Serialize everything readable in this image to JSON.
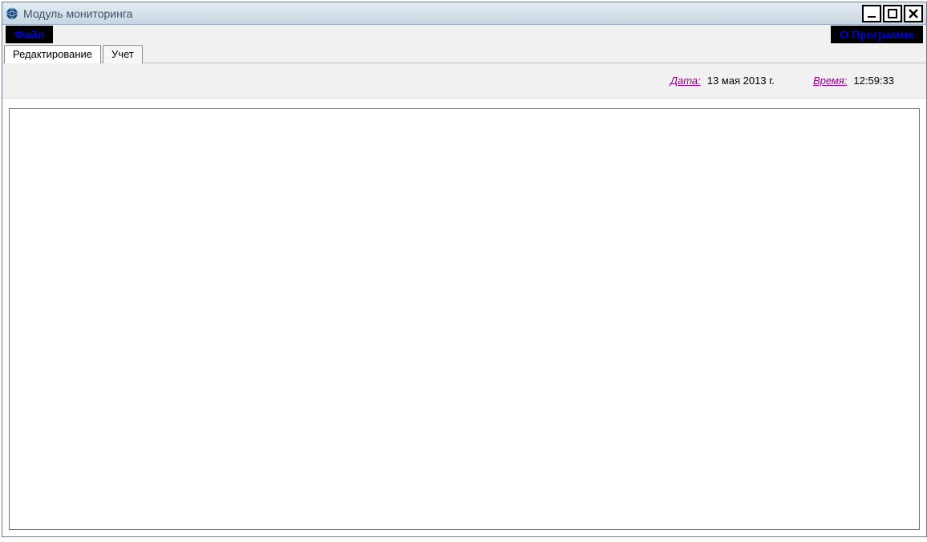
{
  "window": {
    "title": "Модуль мониторинга"
  },
  "menubar": {
    "file_label": "Файл",
    "about_label": "О Программе"
  },
  "tabs": {
    "edit_label": "Редактирование",
    "account_label": "Учет"
  },
  "status": {
    "date_label": "Дата:",
    "date_value": "13 мая 2013 г.",
    "time_label": "Время:",
    "time_value": "12:59:33"
  }
}
